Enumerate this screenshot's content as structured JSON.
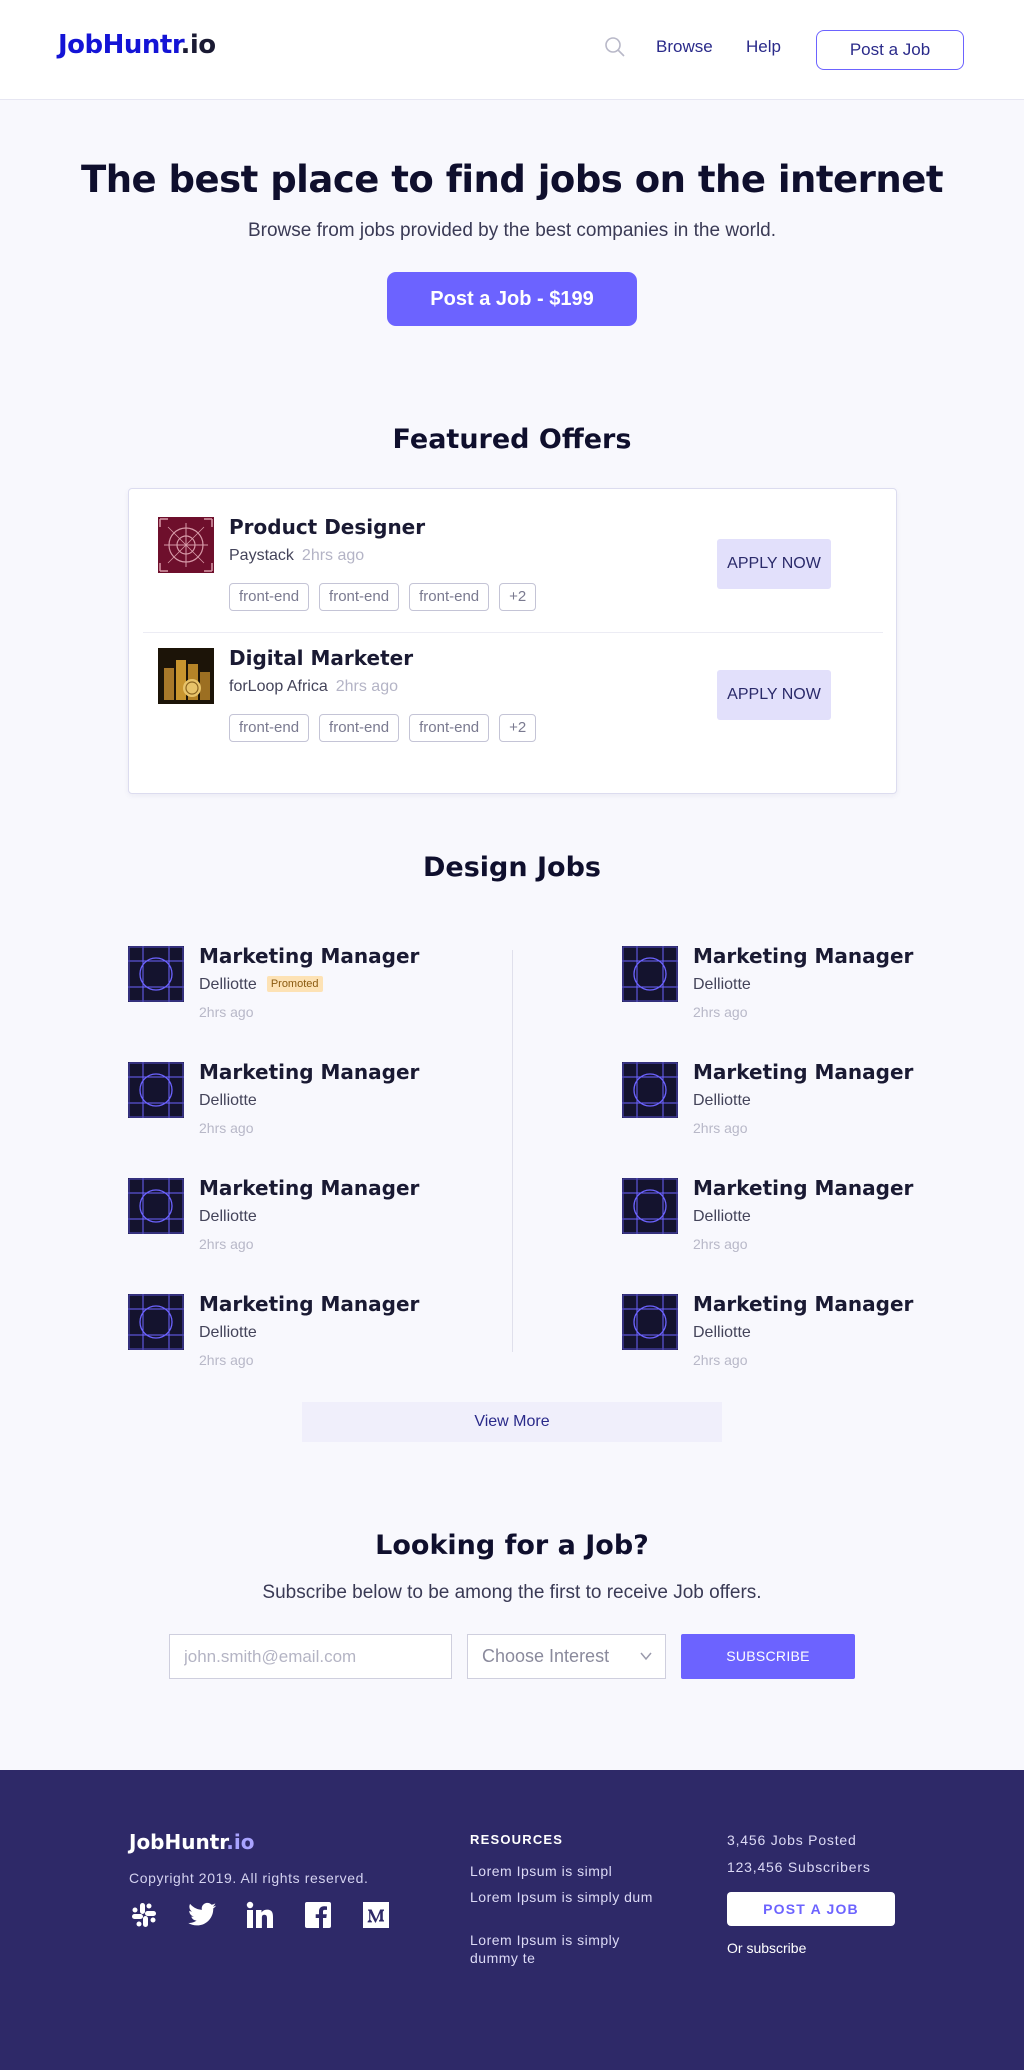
{
  "header": {
    "logo_main": "JobHuntr",
    "logo_suffix": ".io",
    "search_icon": "search-icon",
    "nav_browse": "Browse",
    "nav_help": "Help",
    "post_button": "Post a Job"
  },
  "hero": {
    "title": "The best place to find jobs on the internet",
    "subtitle": "Browse from jobs provided by the best companies in the world.",
    "cta": "Post a Job - $199"
  },
  "featured": {
    "title": "Featured Offers",
    "offers": [
      {
        "title": "Product Designer",
        "company": "Paystack",
        "time": "2hrs ago",
        "tags": [
          "front-end",
          "front-end",
          "front-end",
          "+2"
        ],
        "apply": "APPLY NOW"
      },
      {
        "title": "Digital Marketer",
        "company": "forLoop Africa",
        "time": "2hrs ago",
        "tags": [
          "front-end",
          "front-end",
          "front-end",
          "+2"
        ],
        "apply": "APPLY NOW"
      }
    ]
  },
  "design_jobs": {
    "title": "Design Jobs",
    "promoted_label": "Promoted",
    "jobs": [
      {
        "title": "Marketing Manager",
        "company": "Delliotte",
        "time": "2hrs ago"
      },
      {
        "title": "Marketing Manager",
        "company": "Delliotte",
        "time": "2hrs ago"
      },
      {
        "title": "Marketing Manager",
        "company": "Delliotte",
        "time": "2hrs ago"
      },
      {
        "title": "Marketing Manager",
        "company": "Delliotte",
        "time": "2hrs ago"
      },
      {
        "title": "Marketing Manager",
        "company": "Delliotte",
        "time": "2hrs ago"
      },
      {
        "title": "Marketing Manager",
        "company": "Delliotte",
        "time": "2hrs ago"
      },
      {
        "title": "Marketing Manager",
        "company": "Delliotte",
        "time": "2hrs ago"
      },
      {
        "title": "Marketing Manager",
        "company": "Delliotte",
        "time": "2hrs ago"
      }
    ],
    "view_more": "View More"
  },
  "subscribe": {
    "title": "Looking for a Job?",
    "text": "Subscribe below to be among the first to receive Job offers.",
    "email_placeholder": "john.smith@email.com",
    "interest_label": "Choose Interest",
    "button": "SUBSCRIBE"
  },
  "footer": {
    "logo_main": "JobHuntr",
    "logo_suffix": ".io",
    "copyright": "Copyright 2019. All rights reserved.",
    "socials": [
      "slack-icon",
      "twitter-icon",
      "linkedin-icon",
      "facebook-icon",
      "medium-icon"
    ],
    "resources_title": "RESOURCES",
    "resources": [
      "Lorem Ipsum is simpl",
      "Lorem Ipsum is simply dum",
      "Lorem Ipsum is simply dummy te"
    ],
    "jobs_posted": "3,456 Jobs Posted",
    "subscribers": "123,456 Subscribers",
    "post_button": "POST A JOB",
    "or_subscribe": "Or subscribe"
  },
  "colors": {
    "accent": "#6c63ff",
    "brand_blue": "#1414d6",
    "footer_bg": "#2e2968"
  }
}
